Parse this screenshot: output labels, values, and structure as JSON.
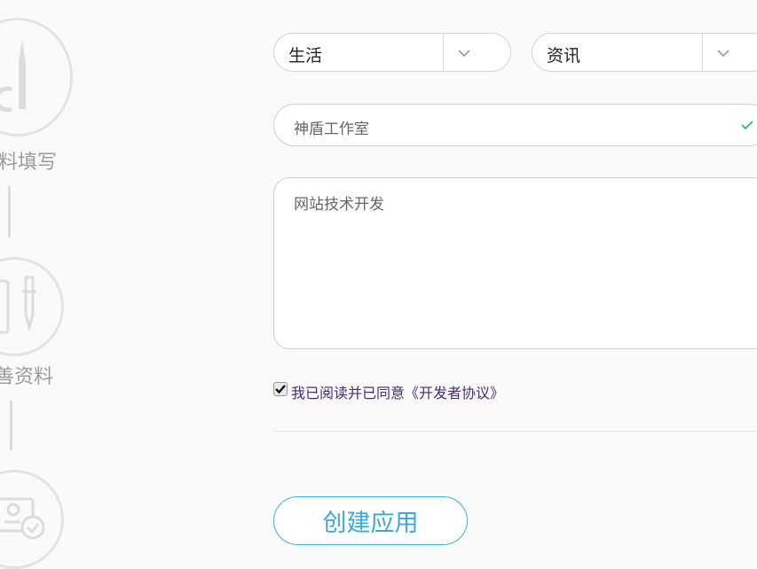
{
  "sidebar": {
    "steps": [
      {
        "label": "料填写",
        "icon": "pen-icon"
      },
      {
        "label": "善资料",
        "icon": "document-pen-icon"
      },
      {
        "label": "",
        "icon": "certificate-check-icon"
      }
    ]
  },
  "form": {
    "category_select": {
      "value": "生活"
    },
    "subcategory_select": {
      "value": "资讯"
    },
    "company_input": {
      "value": "神盾工作室"
    },
    "description_textarea": {
      "value": "网站技术开发"
    },
    "agreement": {
      "label": "我已阅读并已同意《开发者协议》",
      "checked": true
    },
    "submit_label": "创建应用"
  },
  "colors": {
    "accent": "#3aa9d8",
    "valid_check": "#2fbf71",
    "agreement_text": "#4a2a7a"
  }
}
